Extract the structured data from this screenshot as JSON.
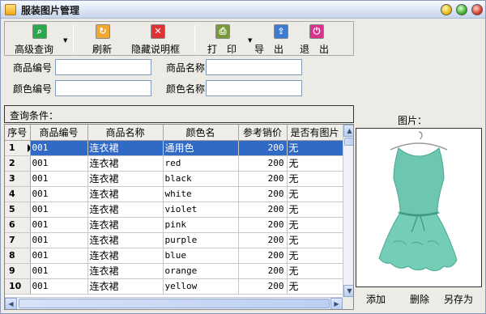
{
  "window": {
    "title": "服装图片管理"
  },
  "toolbar": {
    "advanced_search": "高级查询",
    "refresh": "刷新",
    "hide_help": "隐藏说明框",
    "print": "打　印",
    "export": "导　出",
    "exit": "退　出"
  },
  "filters": {
    "product_code_label": "商品编号",
    "product_code_value": "",
    "product_name_label": "商品名称",
    "product_name_value": "",
    "color_code_label": "颜色编号",
    "color_code_value": "",
    "color_name_label": "颜色名称",
    "color_name_value": ""
  },
  "query_conditions_label": "查询条件：",
  "table": {
    "columns": [
      "序号",
      "商品编号",
      "商品名称",
      "颜色名",
      "参考销价",
      "是否有图片"
    ],
    "rows": [
      [
        "1",
        "001",
        "连衣裙",
        "通用色",
        "200",
        "无"
      ],
      [
        "2",
        "001",
        "连衣裙",
        "red",
        "200",
        "无"
      ],
      [
        "3",
        "001",
        "连衣裙",
        "black",
        "200",
        "无"
      ],
      [
        "4",
        "001",
        "连衣裙",
        "white",
        "200",
        "无"
      ],
      [
        "5",
        "001",
        "连衣裙",
        "violet",
        "200",
        "无"
      ],
      [
        "6",
        "001",
        "连衣裙",
        "pink",
        "200",
        "无"
      ],
      [
        "7",
        "001",
        "连衣裙",
        "purple",
        "200",
        "无"
      ],
      [
        "8",
        "001",
        "连衣裙",
        "blue",
        "200",
        "无"
      ],
      [
        "9",
        "001",
        "连衣裙",
        "orange",
        "200",
        "无"
      ],
      [
        "10",
        "001",
        "连衣裙",
        "yellow",
        "200",
        "无"
      ]
    ],
    "selected_row": 1
  },
  "image_panel": {
    "title": "图片：",
    "image_description_icon": "dress-image",
    "add": "添加",
    "delete": "删除",
    "save_as": "另存为"
  },
  "colors": {
    "selection": "#316ac5",
    "dress": "#6cc6b0"
  }
}
